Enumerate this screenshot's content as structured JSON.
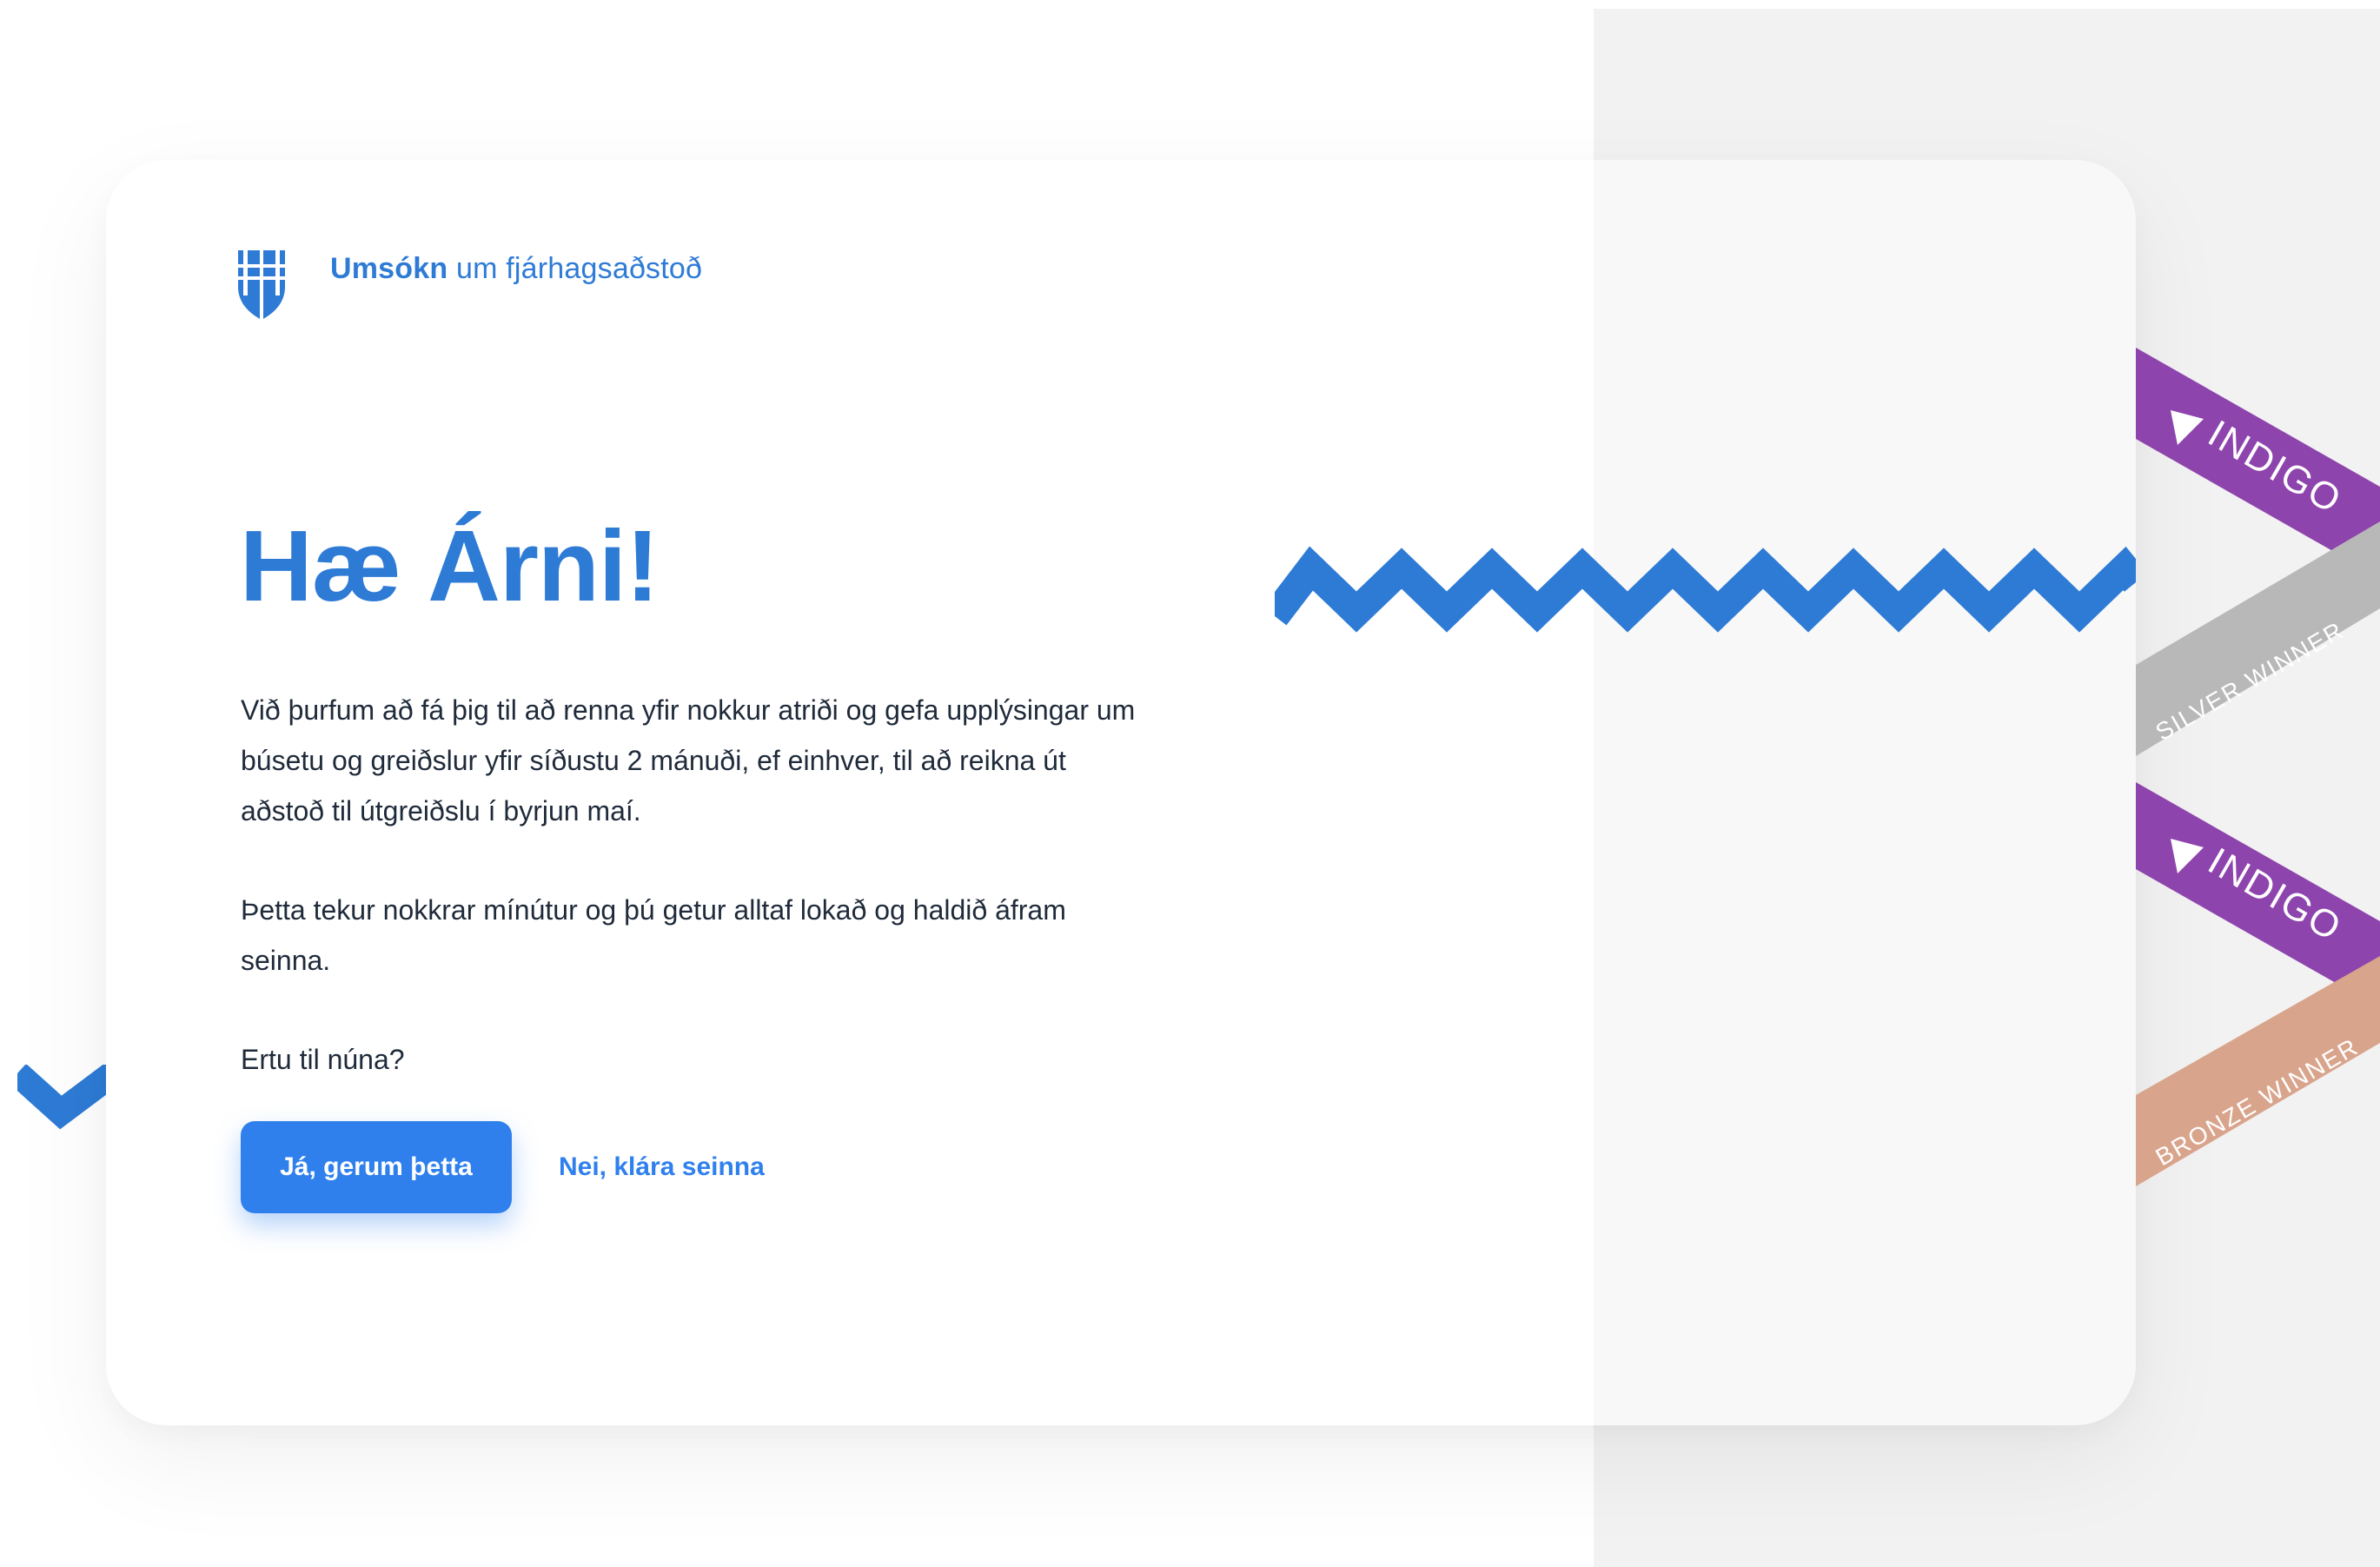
{
  "header": {
    "title_strong": "Umsókn",
    "title_rest": "um fjárhagsaðstoð"
  },
  "main": {
    "greeting": "Hæ Árni!",
    "paragraphs": [
      "Við þurfum að fá þig til að renna yfir nokkur atriði og gefa upplýsingar um búsetu og greiðslur yfir síðustu 2 mánuði, ef einhver, til að reikna út aðstoð til útgreiðslu í byrjun maí.",
      "Þetta tekur nokkrar mínútur og þú getur alltaf lokað og haldið áfram seinna.",
      "Ertu til núna?"
    ],
    "primary_button": "Já, gerum þetta",
    "secondary_button": "Nei, klára seinna"
  },
  "ribbons": [
    "INDIGO",
    "SILVER WINNER",
    "INDIGO",
    "BRONZE WINNER"
  ],
  "icons": {
    "logo": "city-crest-icon",
    "zigzag": "zigzag-decoration"
  },
  "colors": {
    "brand_blue": "#2e7bd6",
    "button_blue": "#2f80ed",
    "indigo": "#8e44ad",
    "silver": "#b5b5b5",
    "bronze": "#d8a087",
    "background_gray": "#f2f2f2"
  }
}
